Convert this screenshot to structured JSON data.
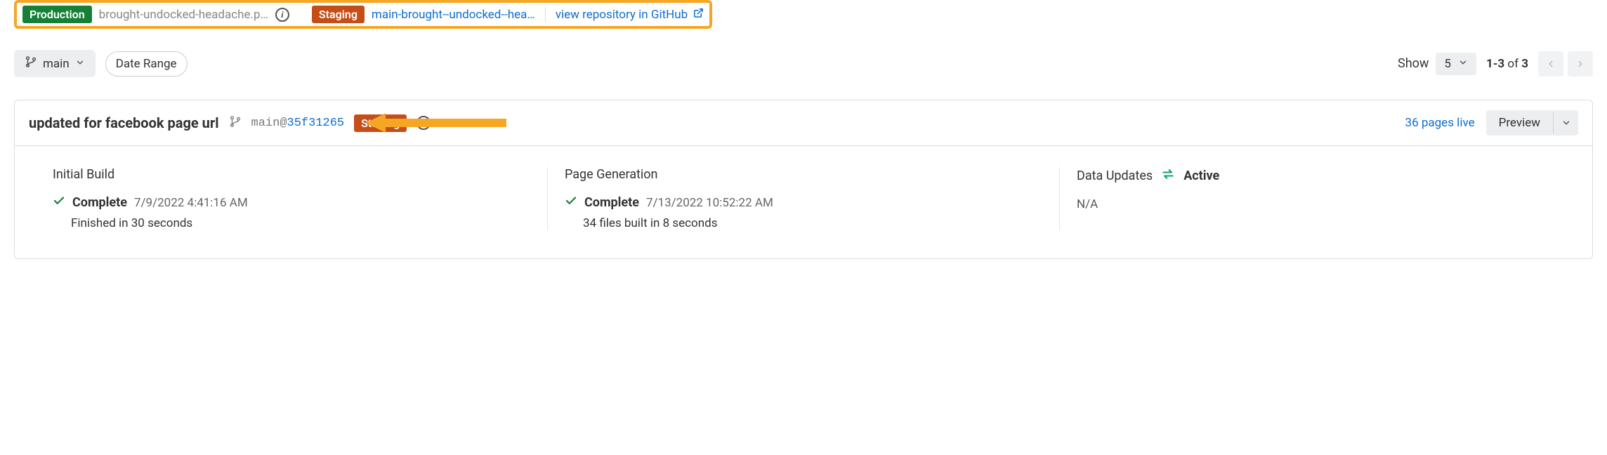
{
  "env_bar": {
    "production_label": "Production",
    "production_url": "brought-undocked-headache.p…",
    "staging_label": "Staging",
    "staging_url": "main-brought--undocked--hea…",
    "view_repo": "view repository in GitHub"
  },
  "toolbar": {
    "branch": "main",
    "date_range": "Date Range",
    "show_label": "Show",
    "show_value": "5",
    "pagination_range": "1-3",
    "pagination_of": "of",
    "pagination_total": "3"
  },
  "deploy": {
    "title": "updated for facebook page url",
    "branch": "main",
    "commit": "35f31265",
    "staging_label": "Staging",
    "pages_live": "36 pages live",
    "preview": "Preview"
  },
  "columns": {
    "initial_build": {
      "title": "Initial Build",
      "status": "Complete",
      "timestamp": "7/9/2022  4:41:16 AM",
      "detail": "Finished in 30 seconds"
    },
    "page_gen": {
      "title": "Page Generation",
      "status": "Complete",
      "timestamp": "7/13/2022  10:52:22 AM",
      "detail": "34 files built in 8 seconds"
    },
    "data_updates": {
      "title": "Data Updates",
      "active": "Active",
      "value": "N/A"
    }
  }
}
